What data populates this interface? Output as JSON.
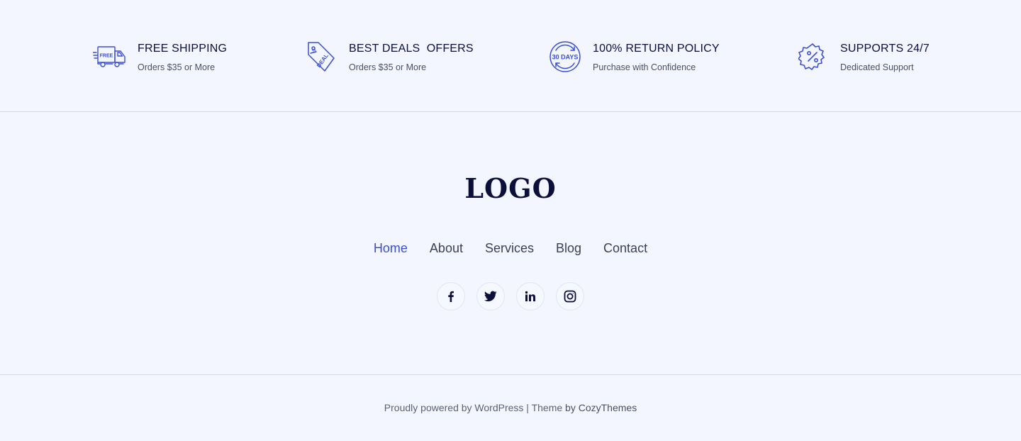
{
  "features": [
    {
      "title": "FREE SHIPPING",
      "subtitle": "Orders $35 or More",
      "icon": "truck-free-icon",
      "icon_text": "FREE"
    },
    {
      "title": "BEST DEALS  OFFERS",
      "subtitle": "Orders $35 or More",
      "icon": "deal-tag-icon",
      "icon_text": "DEAL"
    },
    {
      "title": "100% RETURN POLICY",
      "subtitle": "Purchase with Confidence",
      "icon": "thirty-days-icon",
      "icon_text": "30 DAYS"
    },
    {
      "title": "SUPPORTS 24/7",
      "subtitle": "Dedicated Support",
      "icon": "percent-badge-icon"
    }
  ],
  "logo": {
    "text": "LOGO"
  },
  "nav": {
    "items": [
      {
        "label": "Home",
        "active": true
      },
      {
        "label": "About",
        "active": false
      },
      {
        "label": "Services",
        "active": false
      },
      {
        "label": "Blog",
        "active": false
      },
      {
        "label": "Contact",
        "active": false
      }
    ]
  },
  "social": [
    "facebook-icon",
    "twitter-icon",
    "linkedin-icon",
    "instagram-icon"
  ],
  "footer": {
    "powered": "Proudly powered by WordPress",
    "separator": " | ",
    "theme_prefix": "Theme ",
    "theme_by": "by CozyThemes"
  },
  "colors": {
    "accent": "#3a4ed6",
    "background": "#f3f6ff",
    "text_dark": "#0b0f3a",
    "divider": "#d6d9e3"
  }
}
